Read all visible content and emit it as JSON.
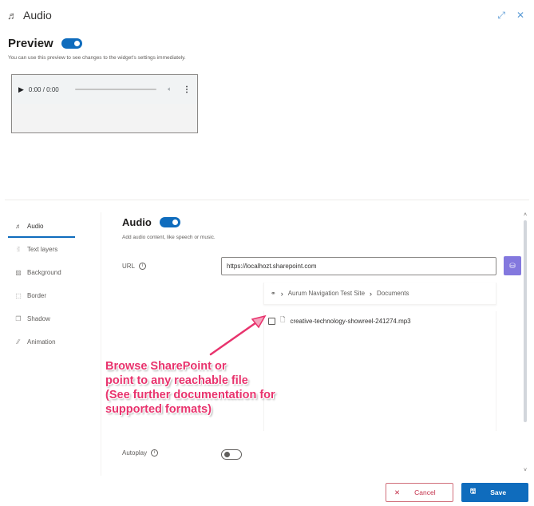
{
  "window": {
    "title": "Audio",
    "title_icon": "music-note-icon",
    "expand_icon": "expand-icon",
    "close_icon": "close-icon"
  },
  "preview": {
    "heading": "Preview",
    "toggle_on": true,
    "description": "You can use this preview to see changes to the widget's settings immediately.",
    "player": {
      "time": "0:00 / 0:00",
      "progress": 0,
      "play_icon": "play-icon",
      "volume_icon": "volume-icon",
      "more_icon": "more-options-icon"
    }
  },
  "sidebar": {
    "items": [
      {
        "label": "Audio",
        "icon": "music-note-icon",
        "active": true
      },
      {
        "label": "Text layers",
        "icon": "text-layers-icon",
        "active": false
      },
      {
        "label": "Background",
        "icon": "background-icon",
        "active": false
      },
      {
        "label": "Border",
        "icon": "border-icon",
        "active": false
      },
      {
        "label": "Shadow",
        "icon": "shadow-icon",
        "active": false
      },
      {
        "label": "Animation",
        "icon": "animation-icon",
        "active": false
      }
    ]
  },
  "audio_section": {
    "heading": "Audio",
    "toggle_on": true,
    "description": "Add audio content, like speech or music.",
    "url_label": "URL",
    "url_value": "https://localhozt.sharepoint.com",
    "browse_button_icon": "sharepoint-icon",
    "breadcrumb": {
      "root_icon": "sharepoint-site-icon",
      "items": [
        "Aurum Navigation Test Site",
        "Documents"
      ]
    },
    "files": [
      {
        "name": "creative-technology-showreel-241274.mp3",
        "checked": false
      }
    ],
    "autoplay_label": "Autoplay",
    "autoplay_on": false
  },
  "annotation": {
    "lines": [
      "Browse SharePoint or",
      "point to any reachable file",
      "(See further documentation for",
      "supported formats)"
    ],
    "color": "#e8336d"
  },
  "footer": {
    "cancel_label": "Cancel",
    "save_label": "Save"
  },
  "colors": {
    "accent": "#0f6cbd",
    "browse_button": "#8378de",
    "cancel": "#c4314b"
  }
}
